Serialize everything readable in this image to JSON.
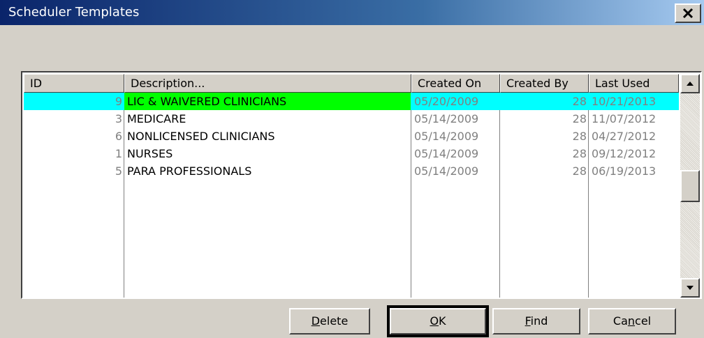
{
  "window": {
    "title": "Scheduler Templates",
    "close_label": "×"
  },
  "columns": [
    "ID",
    "Description...",
    "Created On",
    "Created By",
    "Last Used"
  ],
  "rows": [
    {
      "id": "9",
      "description": "LIC & WAIVERED CLINICIANS",
      "created_on": "05/20/2009",
      "created_by": "28",
      "last_used": "10/21/2013",
      "selected": true
    },
    {
      "id": "3",
      "description": "MEDICARE",
      "created_on": "05/14/2009",
      "created_by": "28",
      "last_used": "11/07/2012"
    },
    {
      "id": "6",
      "description": "NONLICENSED CLINICIANS",
      "created_on": "05/14/2009",
      "created_by": "28",
      "last_used": "04/27/2012"
    },
    {
      "id": "1",
      "description": "NURSES",
      "created_on": "05/14/2009",
      "created_by": "28",
      "last_used": "09/12/2012"
    },
    {
      "id": "5",
      "description": "PARA PROFESSIONALS",
      "created_on": "05/14/2009",
      "created_by": "28",
      "last_used": "06/19/2013"
    }
  ],
  "buttons": {
    "delete": {
      "accel": "D",
      "rest": "elete"
    },
    "ok": {
      "accel": "O",
      "rest": "K"
    },
    "find": {
      "accel": "F",
      "rest": "ind"
    },
    "cancel": {
      "pre": "Ca",
      "accel": "n",
      "rest": "cel"
    }
  },
  "colors": {
    "selected_row": "#00ffff",
    "selected_cell": "#00ff00",
    "title_start": "#0a246a",
    "title_end": "#a6caf0"
  },
  "icons": {
    "close": "close-icon",
    "scroll_up": "scroll-up-icon",
    "scroll_down": "scroll-down-icon"
  }
}
